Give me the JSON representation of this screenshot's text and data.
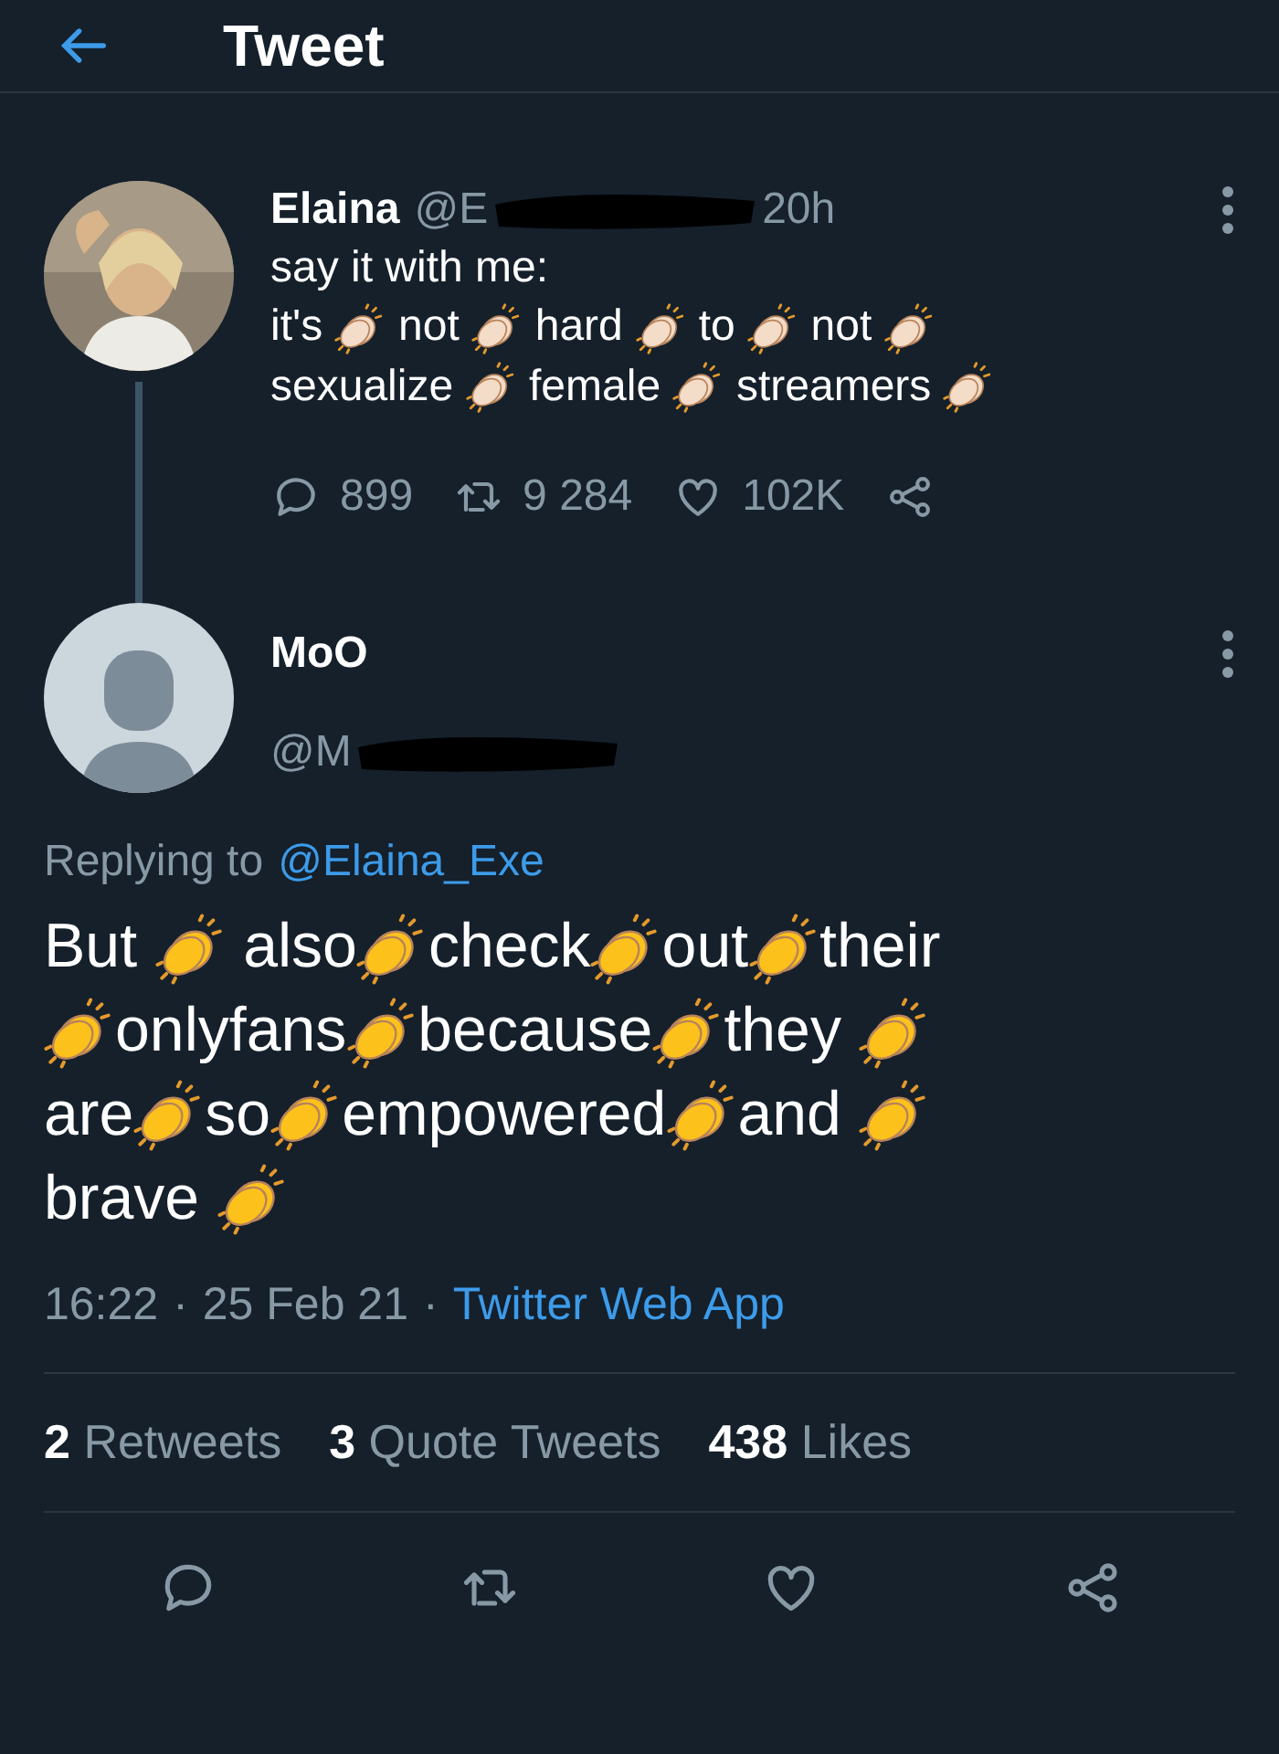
{
  "header": {
    "title": "Tweet"
  },
  "parent_tweet": {
    "name": "Elaina",
    "handle": "@E",
    "time": "20h",
    "lines": [
      [
        {
          "kind": "word",
          "text": "say it with me:"
        }
      ],
      [
        {
          "kind": "word",
          "text": "it's"
        },
        {
          "kind": "space"
        },
        {
          "kind": "clap",
          "color": "#f3dcc8"
        },
        {
          "kind": "space"
        },
        {
          "kind": "word",
          "text": "not"
        },
        {
          "kind": "space"
        },
        {
          "kind": "clap",
          "color": "#f3dcc8"
        },
        {
          "kind": "space"
        },
        {
          "kind": "word",
          "text": "hard"
        },
        {
          "kind": "space"
        },
        {
          "kind": "clap",
          "color": "#f3dcc8"
        },
        {
          "kind": "space"
        },
        {
          "kind": "word",
          "text": "to"
        },
        {
          "kind": "space"
        },
        {
          "kind": "clap",
          "color": "#f3dcc8"
        },
        {
          "kind": "space"
        },
        {
          "kind": "word",
          "text": "not"
        },
        {
          "kind": "space"
        },
        {
          "kind": "clap",
          "color": "#f3dcc8"
        }
      ],
      [
        {
          "kind": "word",
          "text": "sexualize"
        },
        {
          "kind": "space"
        },
        {
          "kind": "clap",
          "color": "#f3dcc8"
        },
        {
          "kind": "space"
        },
        {
          "kind": "word",
          "text": "female"
        },
        {
          "kind": "space"
        },
        {
          "kind": "clap",
          "color": "#f3dcc8"
        },
        {
          "kind": "space"
        },
        {
          "kind": "word",
          "text": "streamers"
        },
        {
          "kind": "space"
        },
        {
          "kind": "clap",
          "color": "#f3dcc8"
        }
      ]
    ],
    "stats": [
      {
        "kind": "reply",
        "count": "899"
      },
      {
        "kind": "retweet",
        "count": "9 284"
      },
      {
        "kind": "like",
        "count": "102K"
      },
      {
        "kind": "share"
      }
    ]
  },
  "main_tweet": {
    "name": "MoO",
    "handle": "@M",
    "replying_label": "Replying to",
    "replying_to": "@Elaina_Exe",
    "lines": [
      [
        {
          "kind": "word",
          "text": "But"
        },
        {
          "kind": "space"
        },
        {
          "kind": "clap",
          "color": "#fcc21b"
        },
        {
          "kind": "space"
        },
        {
          "kind": "word",
          "text": "also"
        },
        {
          "kind": "clap",
          "color": "#fcc21b"
        },
        {
          "kind": "word",
          "text": "check"
        },
        {
          "kind": "clap",
          "color": "#fcc21b"
        },
        {
          "kind": "word",
          "text": "out"
        },
        {
          "kind": "clap",
          "color": "#fcc21b"
        },
        {
          "kind": "word",
          "text": "their"
        }
      ],
      [
        {
          "kind": "clap",
          "color": "#fcc21b"
        },
        {
          "kind": "word",
          "text": "onlyfans"
        },
        {
          "kind": "clap",
          "color": "#fcc21b"
        },
        {
          "kind": "word",
          "text": "because"
        },
        {
          "kind": "clap",
          "color": "#fcc21b"
        },
        {
          "kind": "word",
          "text": "they"
        },
        {
          "kind": "space"
        },
        {
          "kind": "clap",
          "color": "#fcc21b"
        }
      ],
      [
        {
          "kind": "word",
          "text": "are"
        },
        {
          "kind": "clap",
          "color": "#fcc21b"
        },
        {
          "kind": "word",
          "text": "so"
        },
        {
          "kind": "clap",
          "color": "#fcc21b"
        },
        {
          "kind": "word",
          "text": "empowered"
        },
        {
          "kind": "clap",
          "color": "#fcc21b"
        },
        {
          "kind": "word",
          "text": "and"
        },
        {
          "kind": "space"
        },
        {
          "kind": "clap",
          "color": "#fcc21b"
        }
      ],
      [
        {
          "kind": "word",
          "text": "brave"
        },
        {
          "kind": "space"
        },
        {
          "kind": "clap",
          "color": "#fcc21b"
        }
      ]
    ],
    "meta": [
      {
        "text": "16:22",
        "link": false
      },
      {
        "text": "·",
        "link": false
      },
      {
        "text": "25 Feb 21",
        "link": false
      },
      {
        "text": "·",
        "link": false
      },
      {
        "text": "Twitter Web App",
        "link": true
      }
    ],
    "counts": [
      "**2** Retweets",
      "**3** Quote Tweets",
      "**438** Likes"
    ]
  },
  "actions": [
    {
      "kind": "reply"
    },
    {
      "kind": "retweet"
    },
    {
      "kind": "like"
    },
    {
      "kind": "share"
    }
  ]
}
